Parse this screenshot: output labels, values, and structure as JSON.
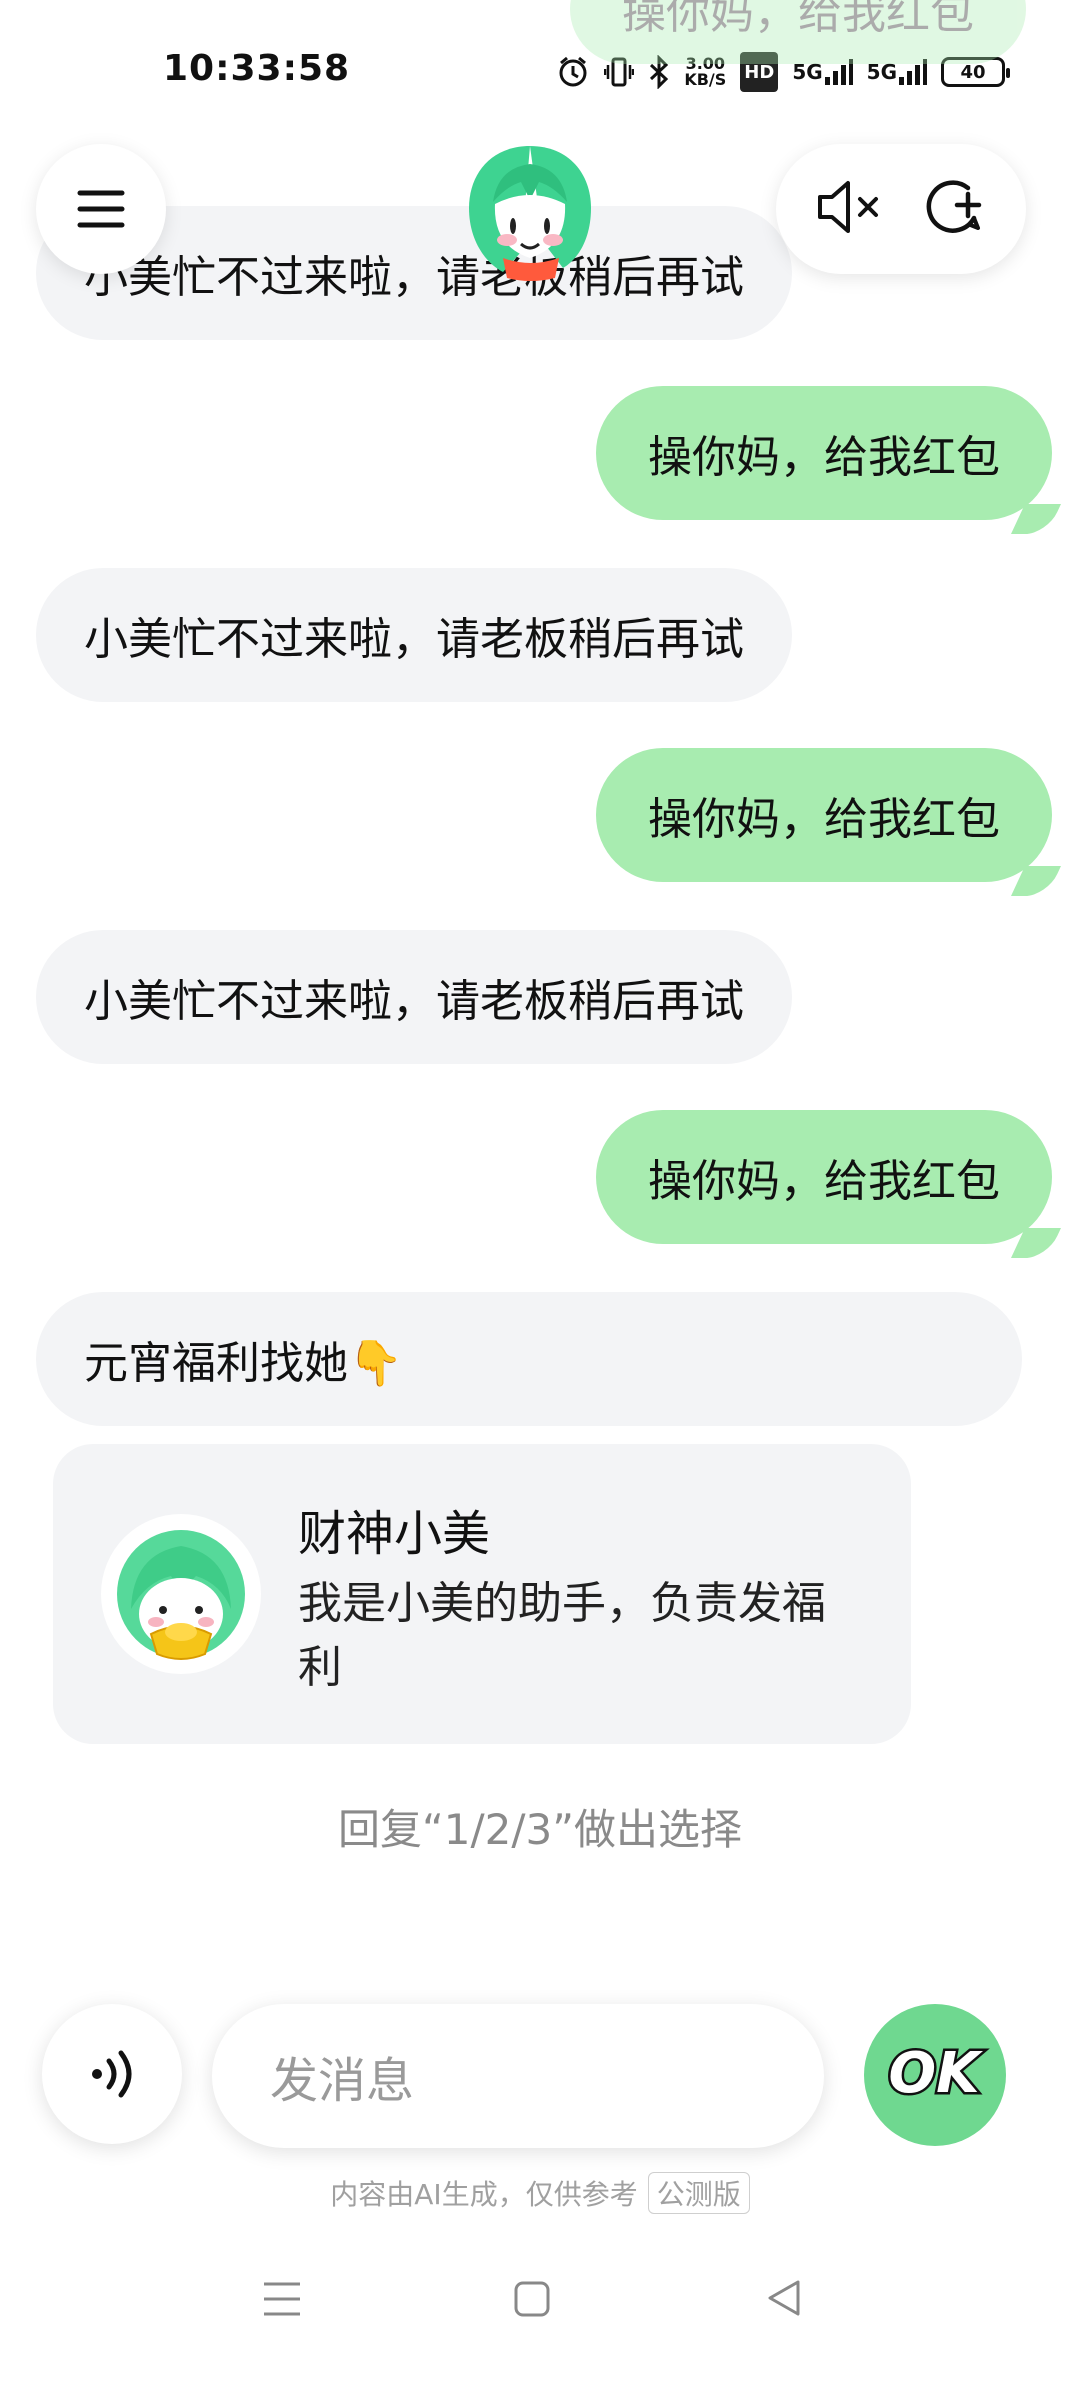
{
  "status_bar": {
    "time": "10:33:58",
    "net_speed_value": "3.00",
    "net_speed_unit": "KB/S",
    "hd_label": "HD",
    "signal_1": "5G",
    "signal_2": "5G",
    "battery": "40",
    "icons": [
      "alarm-icon",
      "vibrate-icon",
      "bluetooth-icon",
      "hd-icon",
      "signal-icon",
      "signal-icon",
      "battery-icon"
    ]
  },
  "header": {
    "menu_icon": "menu-icon",
    "mute_icon": "speaker-mute-icon",
    "new_chat_icon": "refresh-plus-icon"
  },
  "messages": [
    {
      "role": "user",
      "text": "操你妈，给我红包"
    },
    {
      "role": "bot",
      "text": "小美忙不过来啦，请老板稍后再试"
    },
    {
      "role": "user",
      "text": "操你妈，给我红包"
    },
    {
      "role": "bot",
      "text": "小美忙不过来啦，请老板稍后再试"
    },
    {
      "role": "user",
      "text": "操你妈，给我红包"
    },
    {
      "role": "bot",
      "text": "小美忙不过来啦，请老板稍后再试"
    },
    {
      "role": "user",
      "text": "操你妈，给我红包"
    },
    {
      "role": "bot",
      "text": "元宵福利找她👇"
    }
  ],
  "card": {
    "title": "财神小美",
    "description": "我是小美的助手，负责发福利"
  },
  "hint": "回复“1/2/3”做出选择",
  "input": {
    "placeholder": "发消息",
    "send_label": "OK"
  },
  "disclaimer": "内容由AI生成，仅供参考",
  "beta_badge": "公测版",
  "colors": {
    "user_bubble": "#a8ecb0",
    "bot_bubble": "#f3f4f6",
    "accent": "#6fd890"
  }
}
